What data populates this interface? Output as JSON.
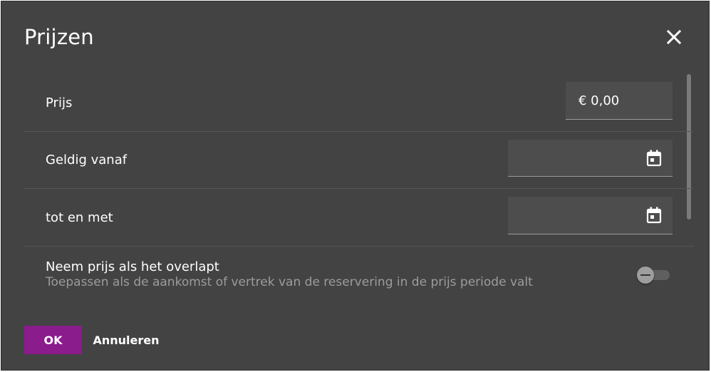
{
  "dialog": {
    "title": "Prijzen",
    "close_icon": "close-icon"
  },
  "fields": {
    "price": {
      "label": "Prijs",
      "value": "€ 0,00"
    },
    "valid_from": {
      "label": "Geldig vanaf",
      "value": "",
      "icon": "calendar-icon"
    },
    "valid_until": {
      "label": "tot en met",
      "value": "",
      "icon": "calendar-icon"
    }
  },
  "overlap": {
    "label": "Neem prijs als het overlapt",
    "description": "Toepassen als de aankomst of vertrek van de reservering in de prijs periode valt",
    "enabled": false
  },
  "actions": {
    "ok_label": "OK",
    "cancel_label": "Annuleren"
  },
  "colors": {
    "background": "#434343",
    "accent": "#8a1c8c",
    "field_background": "#4d4d4d",
    "secondary_text": "#9c9c9c"
  }
}
